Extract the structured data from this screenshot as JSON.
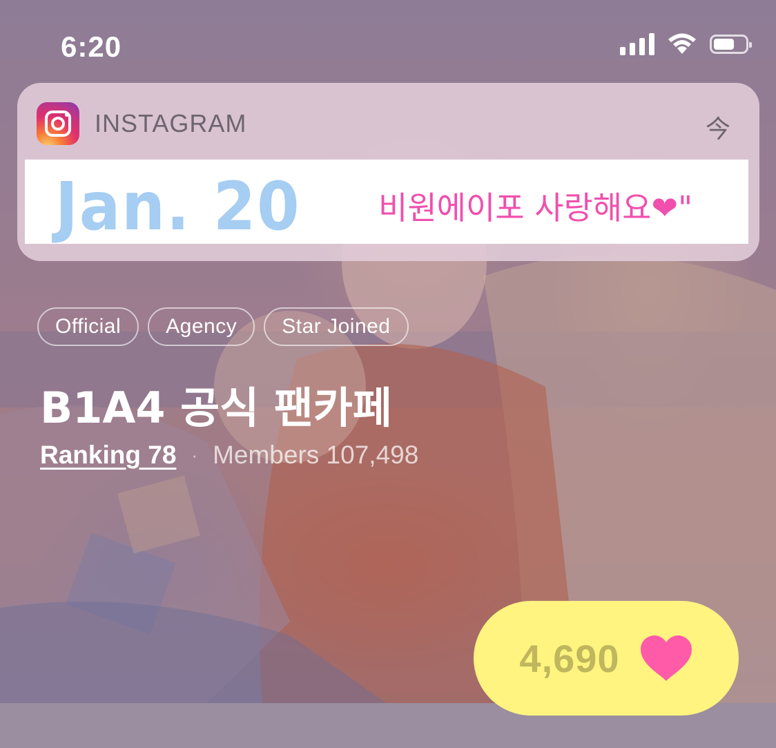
{
  "status_bar": {
    "time": "6:20",
    "battery_level": 0.65
  },
  "notification": {
    "app_name": "INSTAGRAM",
    "time": "今",
    "banner": {
      "date": "Jan.  20",
      "message": "비원에이포 사랑해요❤\""
    },
    "colors": {
      "date": "#a6cdf2",
      "message": "#f04fae"
    }
  },
  "cafe": {
    "tags": [
      "Official",
      "Agency",
      "Star Joined"
    ],
    "title": "B1A4 공식 팬카페",
    "ranking": "Ranking 78",
    "separator": "·",
    "members": "Members 107,498"
  },
  "like": {
    "count": "4,690",
    "icon": "heart-icon",
    "colors": {
      "pill": "#fff47f",
      "heart": "#ff5ba8",
      "count": "#bfb65e"
    }
  }
}
